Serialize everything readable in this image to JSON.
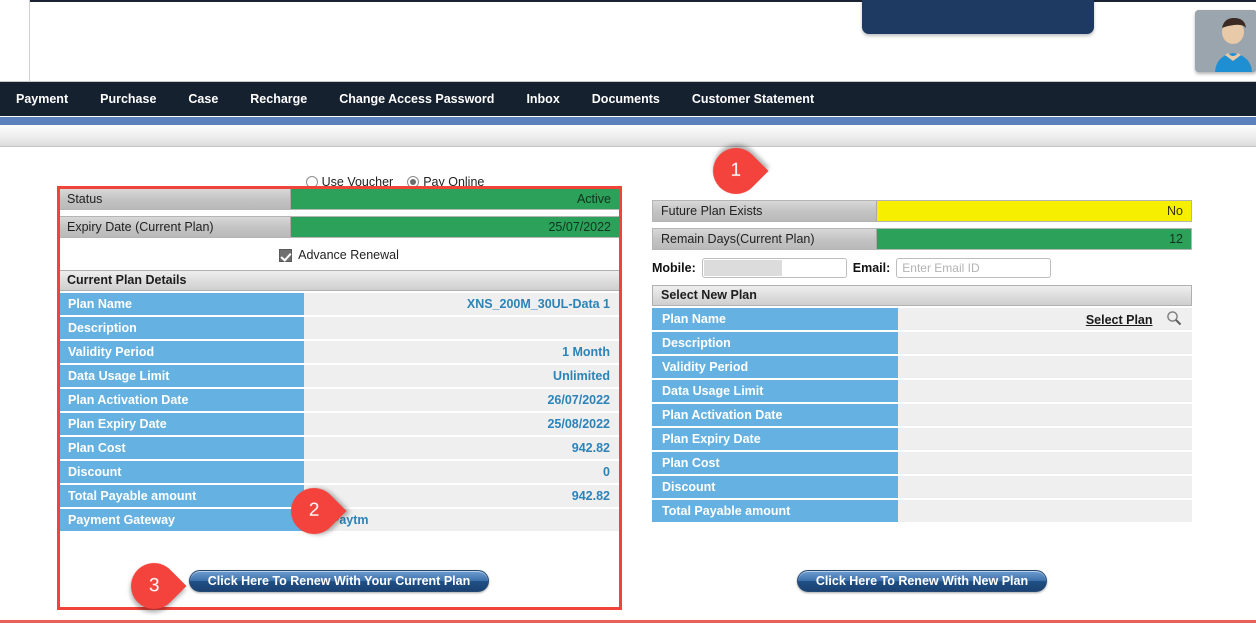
{
  "header": {
    "brand_plate": "",
    "avatar_alt": "user-avatar"
  },
  "nav": {
    "items": [
      {
        "label": "Payment"
      },
      {
        "label": "Purchase"
      },
      {
        "label": "Case"
      },
      {
        "label": "Recharge"
      },
      {
        "label": "Change Access Password"
      },
      {
        "label": "Inbox"
      },
      {
        "label": "Documents"
      },
      {
        "label": "Customer Statement"
      }
    ]
  },
  "payment_mode": {
    "use_voucher_label": "Use Voucher",
    "pay_online_label": "Pay Online",
    "selected": "Pay Online"
  },
  "left_panel": {
    "status_label": "Status",
    "status_value": "Active",
    "expiry_label": "Expiry Date (Current Plan)",
    "expiry_value": "25/07/2022",
    "advance_renewal_label": "Advance Renewal",
    "advance_renewal_checked": true,
    "section_title": "Current Plan Details",
    "rows": [
      {
        "key": "Plan Name",
        "value": "XNS_200M_30UL-Data 1"
      },
      {
        "key": "Description",
        "value": ""
      },
      {
        "key": "Validity Period",
        "value": "1 Month"
      },
      {
        "key": "Data Usage Limit",
        "value": "Unlimited"
      },
      {
        "key": "Plan Activation Date",
        "value": "26/07/2022"
      },
      {
        "key": "Plan Expiry Date",
        "value": "25/08/2022"
      },
      {
        "key": "Plan Cost",
        "value": "942.82"
      },
      {
        "key": "Discount",
        "value": "0"
      },
      {
        "key": "Total Payable amount",
        "value": "942.82"
      }
    ],
    "gateway_key": "Payment Gateway",
    "gateway_option": "Paytm",
    "gateway_selected": true,
    "button_label": "Click Here To Renew With Your Current Plan"
  },
  "right_panel": {
    "future_plan_label": "Future Plan Exists",
    "future_plan_value": "No",
    "remain_days_label": "Remain Days(Current Plan)",
    "remain_days_value": "12",
    "mobile_label": "Mobile:",
    "mobile_value": "",
    "email_label": "Email:",
    "email_value": "",
    "email_placeholder": "Enter Email ID",
    "section_title": "Select New Plan",
    "select_plan_link": "Select Plan",
    "rows": [
      {
        "key": "Plan Name",
        "value": ""
      },
      {
        "key": "Description",
        "value": ""
      },
      {
        "key": "Validity Period",
        "value": ""
      },
      {
        "key": "Data Usage Limit",
        "value": ""
      },
      {
        "key": "Plan Activation Date",
        "value": ""
      },
      {
        "key": "Plan Expiry Date",
        "value": ""
      },
      {
        "key": "Plan Cost",
        "value": ""
      },
      {
        "key": "Discount",
        "value": ""
      },
      {
        "key": "Total Payable amount",
        "value": ""
      }
    ],
    "button_label": "Click Here To Renew With New Plan"
  },
  "callouts": [
    {
      "number": "1"
    },
    {
      "number": "2"
    },
    {
      "number": "3"
    }
  ],
  "colors": {
    "navbar": "#16212f",
    "nav_accent": "#5b82bd",
    "status_green": "#2ba159",
    "warning_yellow": "#f7ef00",
    "row_key_blue": "#65b2e2",
    "row_value_text": "#2b83b8",
    "callout_red": "#f4433c",
    "highlight_border": "#f0433a",
    "button_blue": "#1f4f85"
  }
}
